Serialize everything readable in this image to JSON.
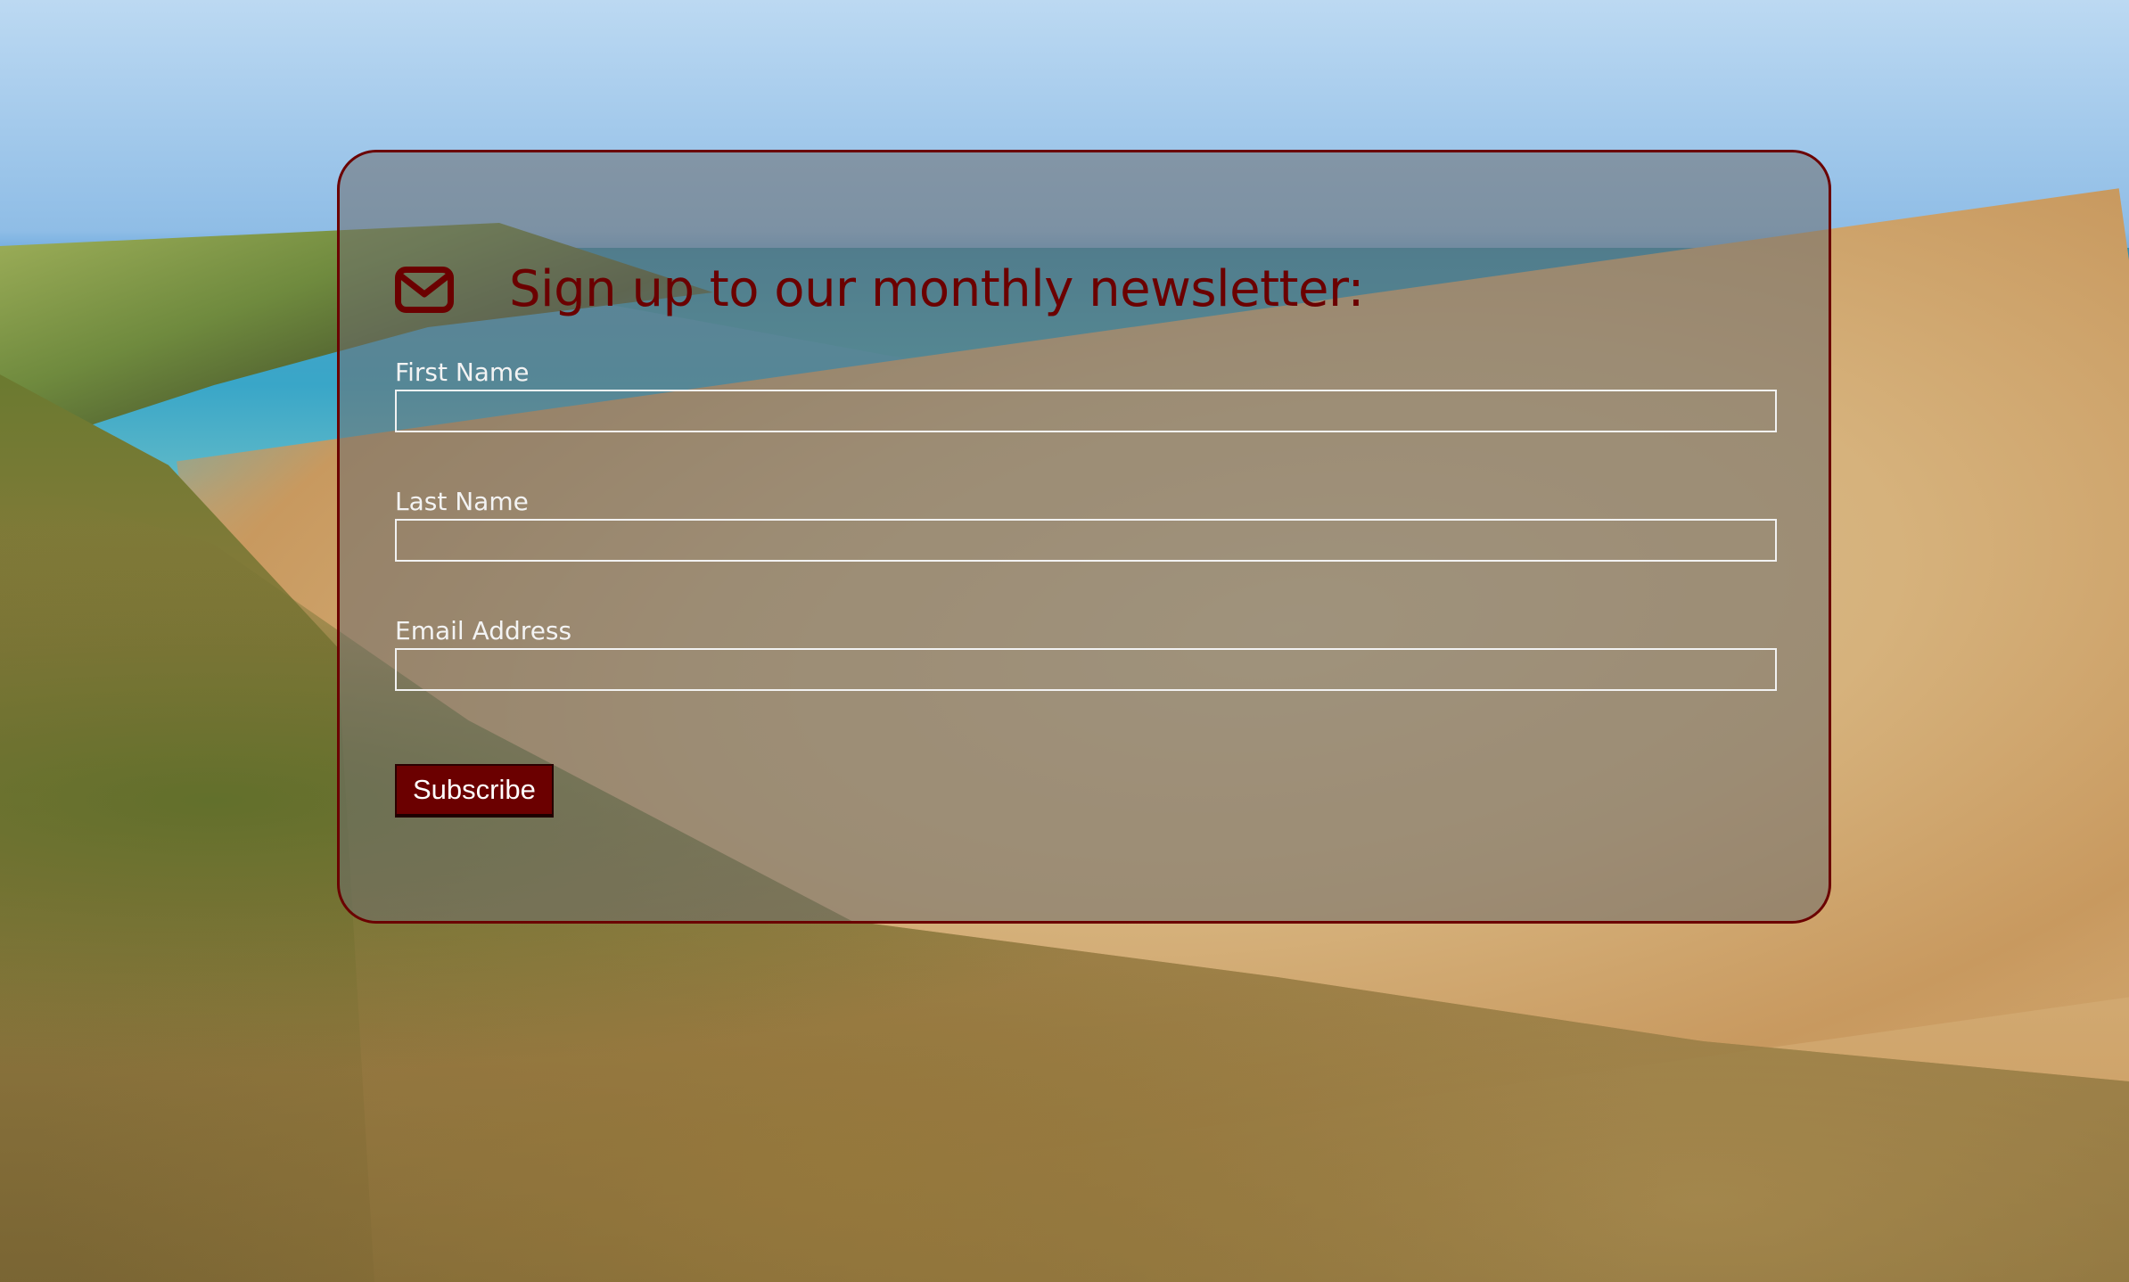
{
  "newsletter": {
    "title": "Sign up to our monthly newsletter:",
    "icon": "envelope-icon",
    "fields": [
      {
        "label": "First Name",
        "value": "",
        "placeholder": ""
      },
      {
        "label": "Last Name",
        "value": "",
        "placeholder": ""
      },
      {
        "label": "Email Address",
        "value": "",
        "placeholder": ""
      }
    ],
    "submit_label": "Subscribe"
  },
  "colors": {
    "accent": "#6b0000",
    "card_background": "rgba(110,110,110,0.55)",
    "label_text": "#f3f3f3"
  }
}
